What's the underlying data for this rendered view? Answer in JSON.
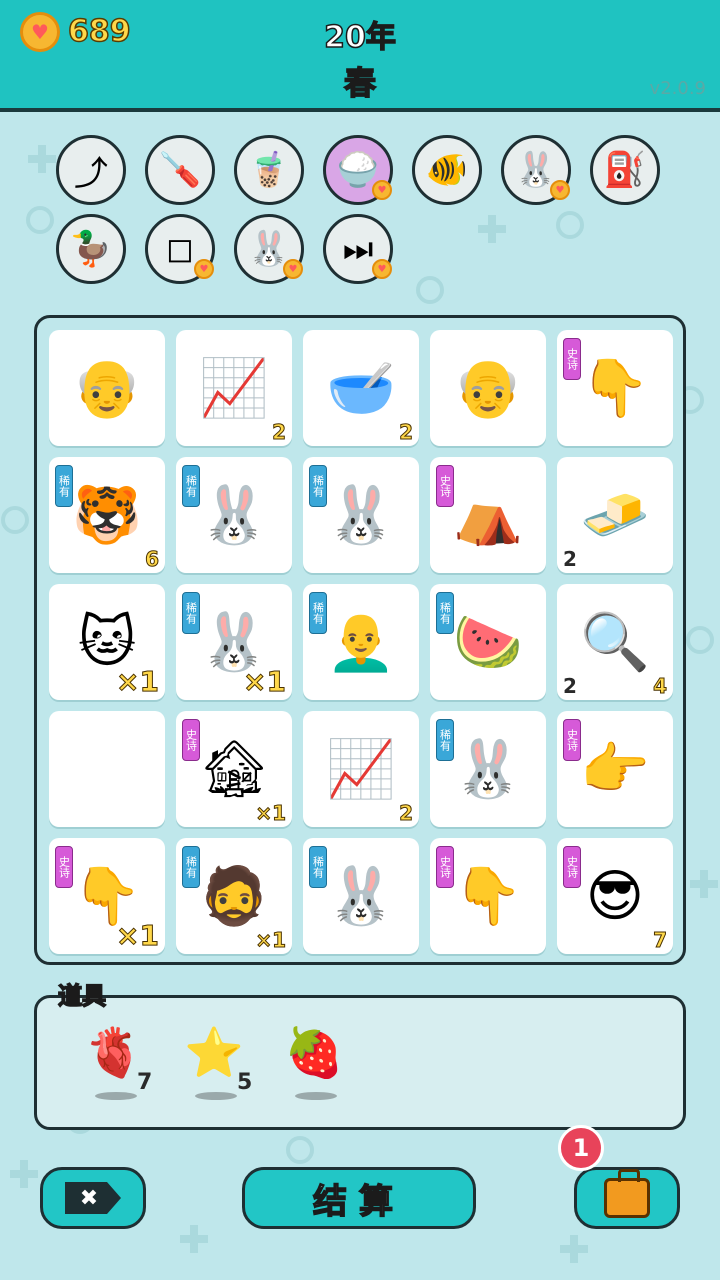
{
  "header": {
    "coins": "689",
    "year": "20年",
    "season": "春",
    "version": "v2.0.9"
  },
  "tools": [
    {
      "name": "arrow-up-card-icon",
      "glyph": "⤴",
      "bg": "#e8eeee",
      "coin": false
    },
    {
      "name": "screwdriver-icon",
      "glyph": "🪛",
      "bg": "#e8eeee",
      "coin": false
    },
    {
      "name": "bubble-tea-icon",
      "glyph": "🧋",
      "bg": "#e8eeee",
      "coin": false
    },
    {
      "name": "rice-bowl-icon",
      "glyph": "🍚",
      "bg": "#d9a6e6",
      "coin": true
    },
    {
      "name": "fishbowl-icon",
      "glyph": "🐠",
      "bg": "#e8eeee",
      "coin": false
    },
    {
      "name": "rabbit-icon",
      "glyph": "🐰",
      "bg": "#e8eeee",
      "coin": true
    },
    {
      "name": "air-pump-icon",
      "glyph": "⛽",
      "bg": "#e8eeee",
      "coin": false
    },
    {
      "name": "duck-pot-icon",
      "glyph": "🦆",
      "bg": "#e8eeee",
      "coin": false
    },
    {
      "name": "sugar-cubes-icon",
      "glyph": "◻",
      "bg": "#e8eeee",
      "coin": true
    },
    {
      "name": "rabbit-icon",
      "glyph": "🐰",
      "bg": "#e8eeee",
      "coin": true
    },
    {
      "name": "skip-icon",
      "glyph": "⏭",
      "bg": "#e8eeee",
      "coin": true
    }
  ],
  "grid": [
    {
      "name": "old-man-glasses-icon",
      "glyph": "👴",
      "tag": "",
      "count": "",
      "left": ""
    },
    {
      "name": "stock-chart-icon",
      "glyph": "📈",
      "tag": "",
      "count": "2",
      "left": ""
    },
    {
      "name": "soup-bowl-icon",
      "glyph": "🥣",
      "tag": "",
      "count": "2",
      "left": ""
    },
    {
      "name": "old-man-glasses-icon",
      "glyph": "👴",
      "tag": "",
      "count": "",
      "left": ""
    },
    {
      "name": "pointing-hand-icon",
      "glyph": "👇",
      "tag": "史诗",
      "count": "",
      "left": ""
    },
    {
      "name": "tiger-icon",
      "glyph": "🐯",
      "tag": "稀有",
      "count": "6",
      "left": ""
    },
    {
      "name": "rabbit-icon",
      "glyph": "🐰",
      "tag": "稀有",
      "count": "",
      "left": ""
    },
    {
      "name": "rabbit-icon",
      "glyph": "🐰",
      "tag": "稀有",
      "count": "",
      "left": ""
    },
    {
      "name": "rabbit-tent-icon",
      "glyph": "⛺",
      "tag": "史诗",
      "count": "",
      "left": ""
    },
    {
      "name": "gold-bars-icon",
      "glyph": "🧈",
      "tag": "",
      "count": "",
      "left": "2"
    },
    {
      "name": "cat-icon",
      "glyph": "🐱",
      "tag": "",
      "count": "×1",
      "left": ""
    },
    {
      "name": "rabbit-icon",
      "glyph": "🐰",
      "tag": "稀有",
      "count": "×1",
      "left": ""
    },
    {
      "name": "bald-man-icon",
      "glyph": "👨‍🦲",
      "tag": "稀有",
      "count": "",
      "left": ""
    },
    {
      "name": "watermelon-icon",
      "glyph": "🍉",
      "tag": "稀有",
      "count": "",
      "left": ""
    },
    {
      "name": "magnifier-coin-icon",
      "glyph": "🔍",
      "tag": "",
      "count": "4",
      "left": "2"
    },
    {
      "name": "empty-cell",
      "glyph": "",
      "tag": "",
      "count": "",
      "left": ""
    },
    {
      "name": "haunted-house-icon",
      "glyph": "🏚",
      "tag": "史诗",
      "count": "×1",
      "left": ""
    },
    {
      "name": "stock-chart-icon",
      "glyph": "📈",
      "tag": "",
      "count": "2",
      "left": ""
    },
    {
      "name": "rabbit-icon",
      "glyph": "🐰",
      "tag": "稀有",
      "count": "",
      "left": ""
    },
    {
      "name": "pointing-hand-icon",
      "glyph": "👉",
      "tag": "史诗",
      "count": "",
      "left": ""
    },
    {
      "name": "pointing-hand-icon",
      "glyph": "👇",
      "tag": "史诗",
      "count": "×1",
      "left": ""
    },
    {
      "name": "man-hat-icon",
      "glyph": "🧔",
      "tag": "稀有",
      "count": "×1",
      "left": ""
    },
    {
      "name": "rabbit-icon",
      "glyph": "🐰",
      "tag": "稀有",
      "count": "",
      "left": ""
    },
    {
      "name": "pointing-hand-icon",
      "glyph": "👇",
      "tag": "史诗",
      "count": "",
      "left": ""
    },
    {
      "name": "green-hat-man-icon",
      "glyph": "😎",
      "tag": "史诗",
      "count": "7",
      "left": ""
    }
  ],
  "props": {
    "label": "道具",
    "items": [
      {
        "name": "liver-icon",
        "glyph": "🫀",
        "count": "7"
      },
      {
        "name": "star-icon",
        "glyph": "⭐",
        "count": "5"
      },
      {
        "name": "bayberry-icon",
        "glyph": "🍓",
        "count": ""
      }
    ]
  },
  "buttons": {
    "close": "✖",
    "settle": "结算",
    "bag_badge": "1"
  },
  "colors": {
    "header": "#1fc3c1",
    "background": "#bfe7eb",
    "rare_tag": "#3aa7d8",
    "epic_tag": "#d65ad8",
    "count_yellow": "#ffd84a"
  }
}
